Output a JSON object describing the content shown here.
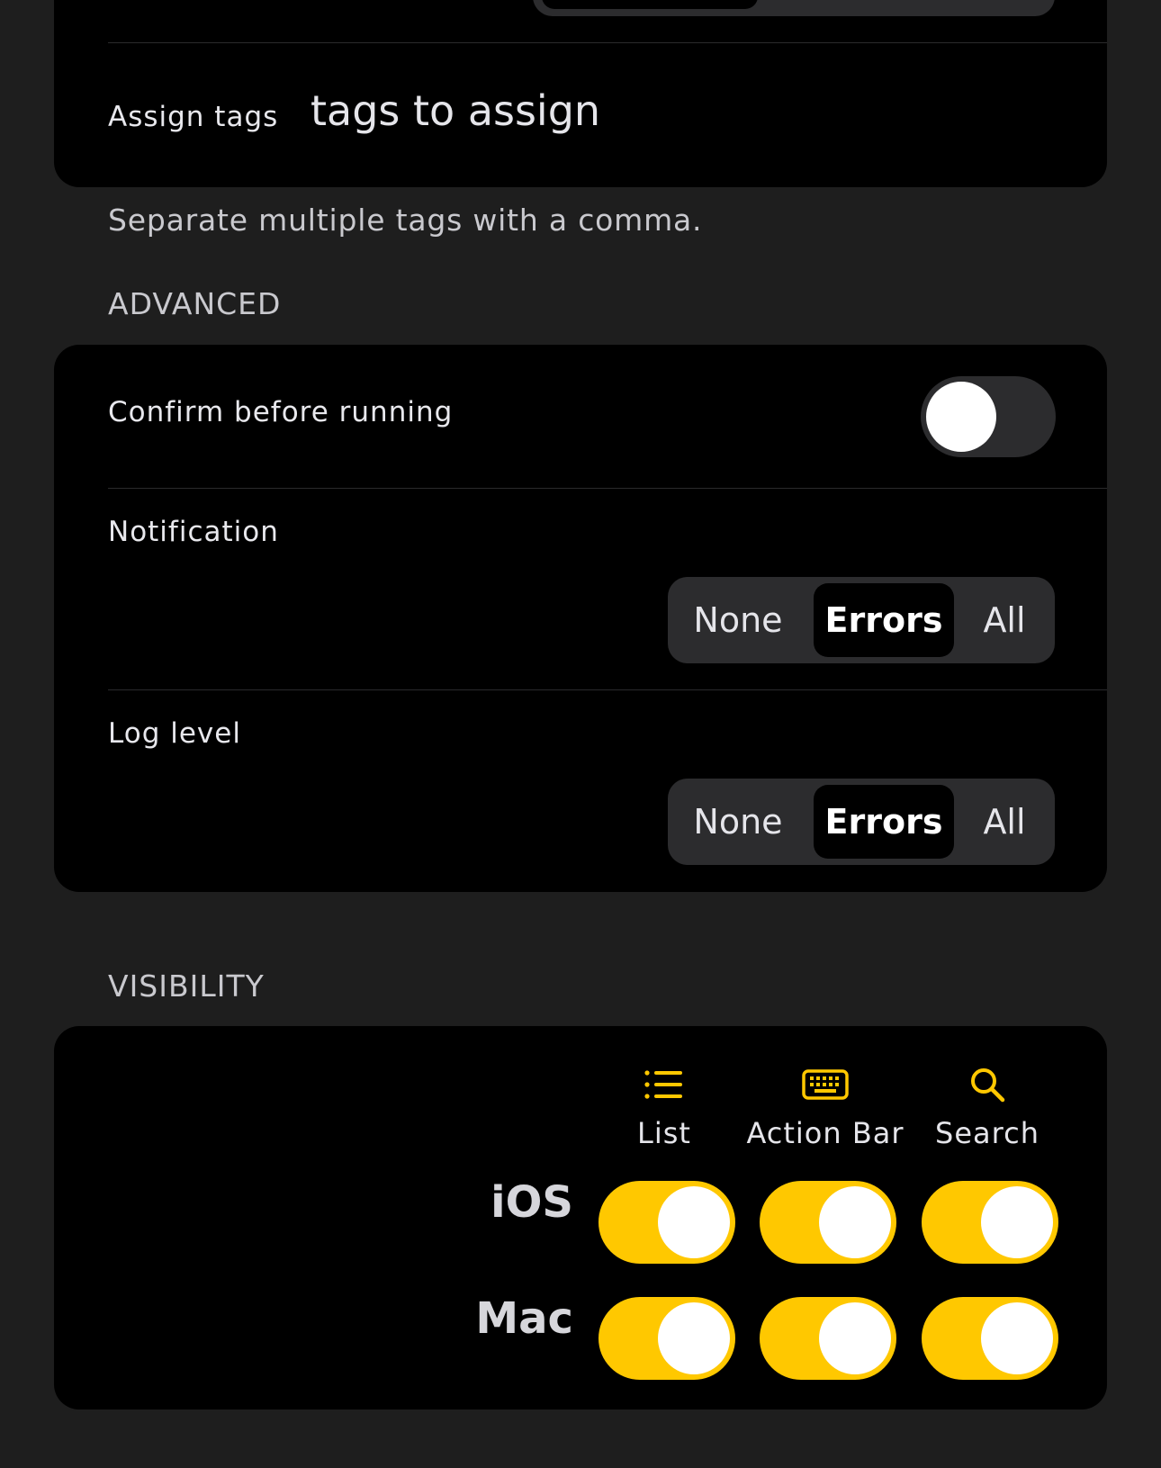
{
  "colors": {
    "accent": "#ffc800",
    "background": "#1e1e1e",
    "card": "#000000"
  },
  "tags": {
    "label": "Assign tags",
    "value": "tags to assign",
    "footnote": "Separate multiple tags with a comma."
  },
  "advanced": {
    "header": "ADVANCED",
    "confirm": {
      "label": "Confirm before running",
      "enabled": false
    },
    "notification": {
      "label": "Notification",
      "options": [
        "None",
        "Errors",
        "All"
      ],
      "selected": "Errors"
    },
    "log_level": {
      "label": "Log level",
      "options": [
        "None",
        "Errors",
        "All"
      ],
      "selected": "Errors"
    }
  },
  "visibility": {
    "header": "VISIBILITY",
    "columns": [
      {
        "label": "List",
        "icon": "list-icon"
      },
      {
        "label": "Action Bar",
        "icon": "keyboard-icon"
      },
      {
        "label": "Search",
        "icon": "search-icon"
      }
    ],
    "rows": [
      {
        "label": "iOS",
        "values": [
          true,
          true,
          true
        ]
      },
      {
        "label": "Mac",
        "values": [
          true,
          true,
          true
        ]
      }
    ]
  }
}
